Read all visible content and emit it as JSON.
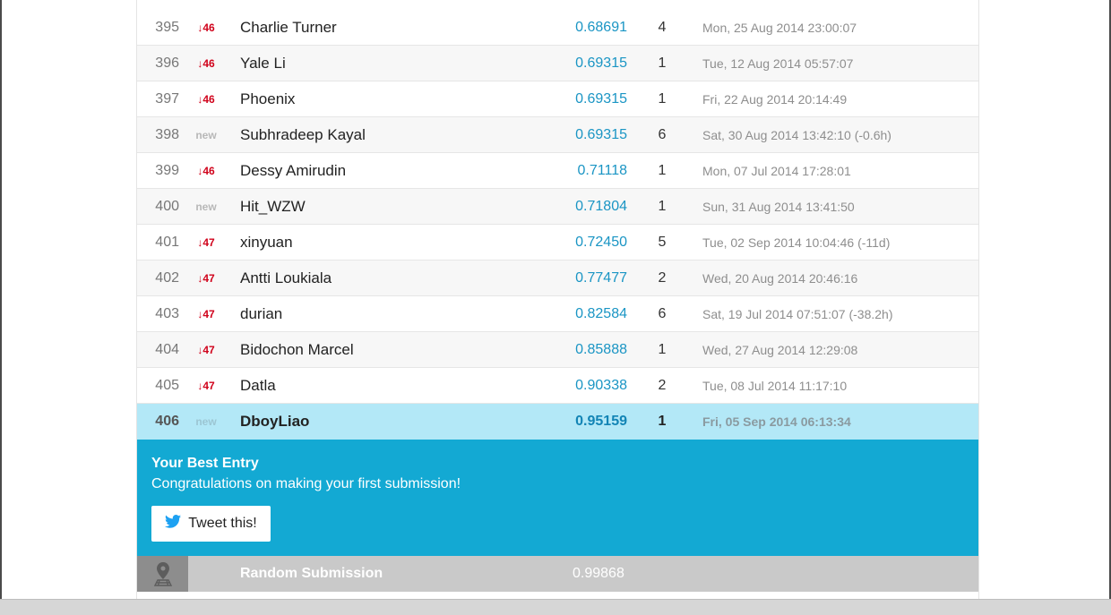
{
  "leaderboard": {
    "rows": [
      {
        "rank": "395",
        "delta": "↓46",
        "is_new": false,
        "name": "Charlie Turner",
        "score": "0.68691",
        "entries": "4",
        "timestamp": "Mon, 25 Aug 2014 23:00:07"
      },
      {
        "rank": "396",
        "delta": "↓46",
        "is_new": false,
        "name": "Yale Li",
        "score": "0.69315",
        "entries": "1",
        "timestamp": "Tue, 12 Aug 2014 05:57:07"
      },
      {
        "rank": "397",
        "delta": "↓46",
        "is_new": false,
        "name": "Phoenix",
        "score": "0.69315",
        "entries": "1",
        "timestamp": "Fri, 22 Aug 2014 20:14:49"
      },
      {
        "rank": "398",
        "delta": "new",
        "is_new": true,
        "name": "Subhradeep Kayal",
        "score": "0.69315",
        "entries": "6",
        "timestamp": "Sat, 30 Aug 2014 13:42:10 (-0.6h)"
      },
      {
        "rank": "399",
        "delta": "↓46",
        "is_new": false,
        "name": "Dessy Amirudin",
        "score": "0.71118",
        "entries": "1",
        "timestamp": "Mon, 07 Jul 2014 17:28:01"
      },
      {
        "rank": "400",
        "delta": "new",
        "is_new": true,
        "name": "Hit_WZW",
        "score": "0.71804",
        "entries": "1",
        "timestamp": "Sun, 31 Aug 2014 13:41:50"
      },
      {
        "rank": "401",
        "delta": "↓47",
        "is_new": false,
        "name": "xinyuan",
        "score": "0.72450",
        "entries": "5",
        "timestamp": "Tue, 02 Sep 2014 10:04:46 (-11d)"
      },
      {
        "rank": "402",
        "delta": "↓47",
        "is_new": false,
        "name": "Antti Loukiala",
        "score": "0.77477",
        "entries": "2",
        "timestamp": "Wed, 20 Aug 2014 20:46:16"
      },
      {
        "rank": "403",
        "delta": "↓47",
        "is_new": false,
        "name": "durian",
        "score": "0.82584",
        "entries": "6",
        "timestamp": "Sat, 19 Jul 2014 07:51:07 (-38.2h)"
      },
      {
        "rank": "404",
        "delta": "↓47",
        "is_new": false,
        "name": "Bidochon Marcel",
        "score": "0.85888",
        "entries": "1",
        "timestamp": "Wed, 27 Aug 2014 12:29:08"
      },
      {
        "rank": "405",
        "delta": "↓47",
        "is_new": false,
        "name": "Datla",
        "score": "0.90338",
        "entries": "2",
        "timestamp": "Tue, 08 Jul 2014 11:17:10"
      },
      {
        "rank": "406",
        "delta": "new",
        "is_new": true,
        "name": "DboyLiao",
        "score": "0.95159",
        "entries": "1",
        "timestamp": "Fri, 05 Sep 2014 06:13:34",
        "is_current_user": true
      }
    ]
  },
  "best_entry": {
    "title": "Your Best Entry",
    "message": "Congratulations on making your first submission!",
    "tweet_label": "Tweet this!"
  },
  "benchmark": {
    "icon": "map-pin-icon",
    "name": "Random Submission",
    "score": "0.99868"
  },
  "colors": {
    "accent": "#13a9d3",
    "highlight_row": "#b3e8f7",
    "score": "#1a95c4",
    "rank_drop": "#d0021b",
    "twitter": "#1da1f2",
    "benchmark_bar": "#c9c9c9"
  }
}
